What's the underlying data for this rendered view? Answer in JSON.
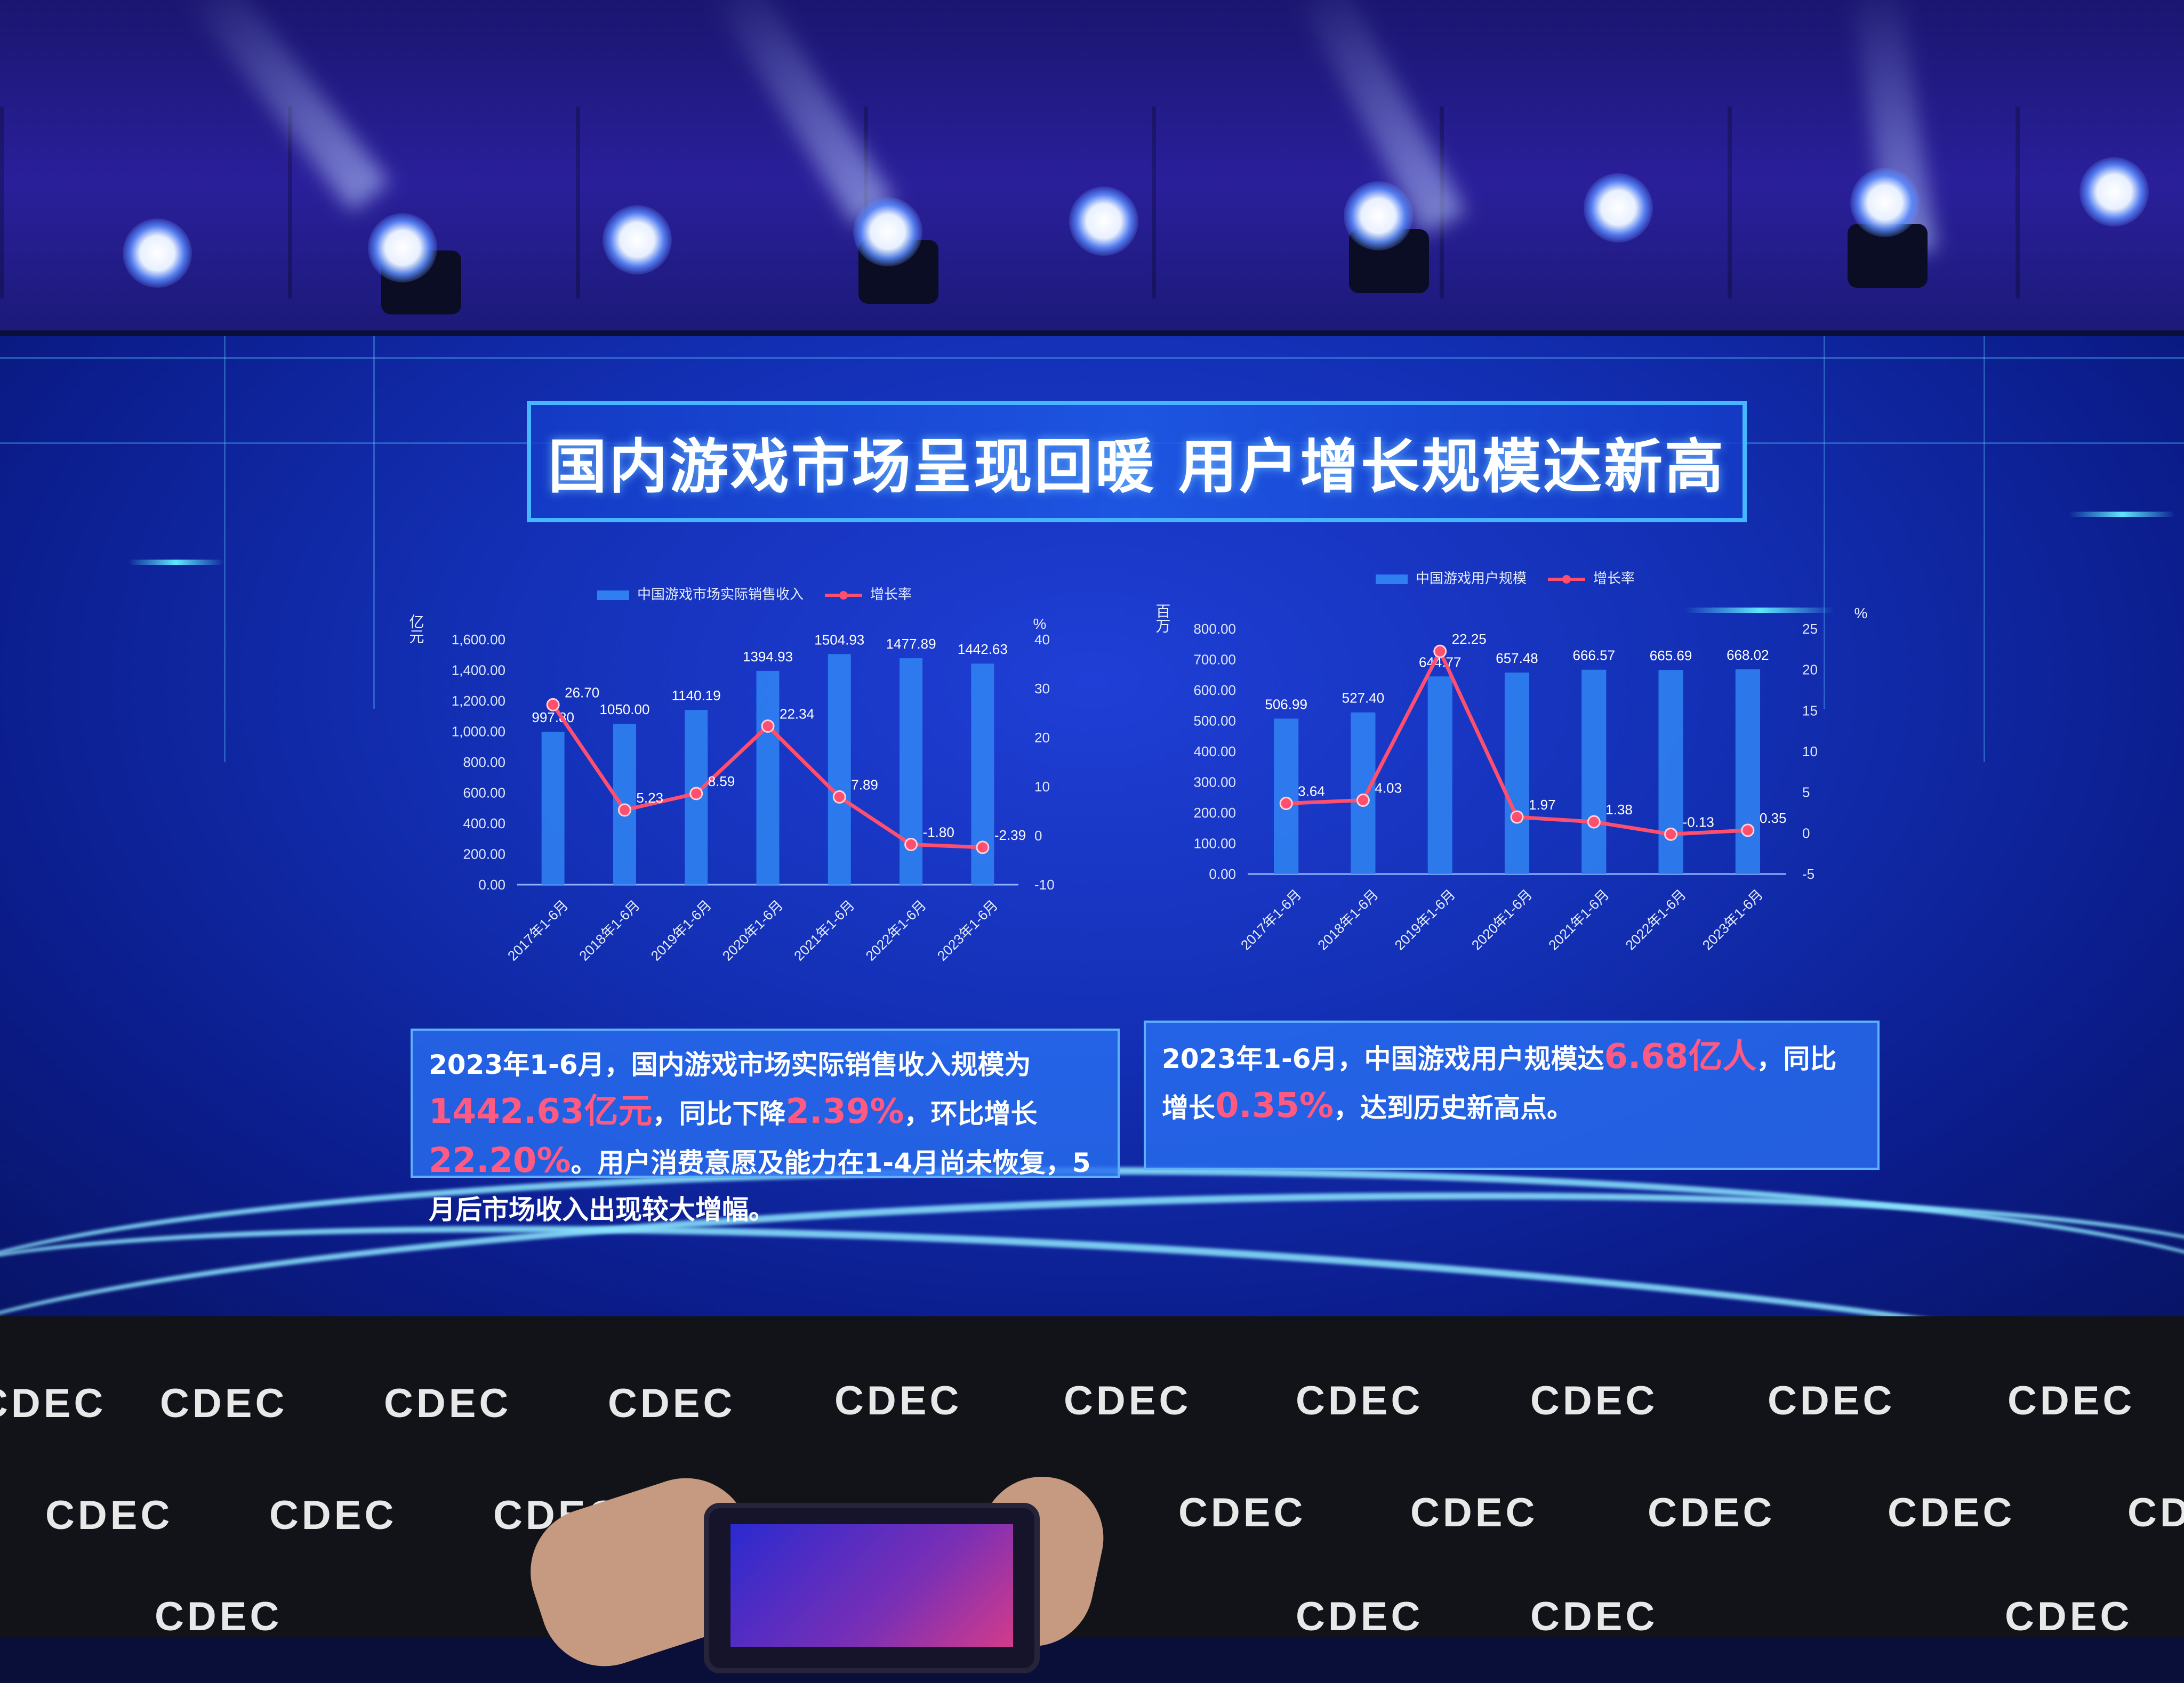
{
  "title": "国内游戏市场呈现回暖 用户增长规模达新高",
  "chart_data": [
    {
      "type": "bar",
      "legend": [
        "中国游戏市场实际销售收入",
        "增长率"
      ],
      "y_axis_unit": "亿元",
      "y2_axis_unit": "%",
      "categories": [
        "2017年1-6月",
        "2018年1-6月",
        "2019年1-6月",
        "2020年1-6月",
        "2021年1-6月",
        "2022年1-6月",
        "2023年1-6月"
      ],
      "bar_values": [
        997.8,
        1050.0,
        1140.19,
        1394.93,
        1504.93,
        1477.89,
        1442.63
      ],
      "bar_labels": [
        "997.80",
        "1050.00",
        "1140.19",
        "1394.93",
        "1504.93",
        "1477.89",
        "1442.63"
      ],
      "line_values": [
        26.7,
        5.23,
        8.59,
        22.34,
        7.89,
        -1.8,
        -2.39
      ],
      "line_labels": [
        "26.70",
        "5.23",
        "8.59",
        "22.34",
        "7.89",
        "-1.80",
        "-2.39"
      ],
      "ylim": [
        0,
        1600
      ],
      "y_ticks": [
        "0.00",
        "200.00",
        "400.00",
        "600.00",
        "800.00",
        "1,000.00",
        "1,200.00",
        "1,400.00",
        "1,600.00"
      ],
      "y2lim": [
        -10,
        40
      ],
      "y2_ticks": [
        "-10",
        "0",
        "10",
        "20",
        "30",
        "40"
      ]
    },
    {
      "type": "bar",
      "legend": [
        "中国游戏用户规模",
        "增长率"
      ],
      "y_axis_unit": "百万",
      "y2_axis_unit": "%",
      "categories": [
        "2017年1-6月",
        "2018年1-6月",
        "2019年1-6月",
        "2020年1-6月",
        "2021年1-6月",
        "2022年1-6月",
        "2023年1-6月"
      ],
      "bar_values": [
        506.99,
        527.4,
        644.77,
        657.48,
        666.57,
        665.69,
        668.02
      ],
      "bar_labels": [
        "506.99",
        "527.40",
        "644.77",
        "657.48",
        "666.57",
        "665.69",
        "668.02"
      ],
      "line_values": [
        3.64,
        4.03,
        22.25,
        1.97,
        1.38,
        -0.13,
        0.35
      ],
      "line_labels": [
        "3.64",
        "4.03",
        "22.25",
        "1.97",
        "1.38",
        "-0.13",
        "0.35"
      ],
      "ylim": [
        0,
        800
      ],
      "y_ticks": [
        "0.00",
        "100.00",
        "200.00",
        "300.00",
        "400.00",
        "500.00",
        "600.00",
        "700.00",
        "800.00"
      ],
      "y2lim": [
        -5,
        25
      ],
      "y2_ticks": [
        "-5",
        "0",
        "5",
        "10",
        "15",
        "20",
        "25"
      ]
    }
  ],
  "summary_left": {
    "p1": "2023年1-6月，国内游戏市场实际销售收入规模为",
    "v1": "1442.63亿元",
    "p2": "，同比下降",
    "v2": "2.39%",
    "p3": "，环比增长",
    "v3": "22.20%",
    "p4": "。用户消费意愿及能力在1-4月尚未恢复，5月后市场收入出现较大增幅。"
  },
  "summary_right": {
    "p1": "2023年1-6月，中国游戏用户规模达",
    "v1": "6.68亿人",
    "p2": "，同比增长",
    "v2": "0.35%",
    "p3": "，达到历史新高点。"
  },
  "backdrop_logo": "CDEC",
  "colors": {
    "bar": "#2f7ff0",
    "line": "#ff4f6e",
    "highlight": "#ff5a82",
    "frame": "#45b6ff"
  }
}
